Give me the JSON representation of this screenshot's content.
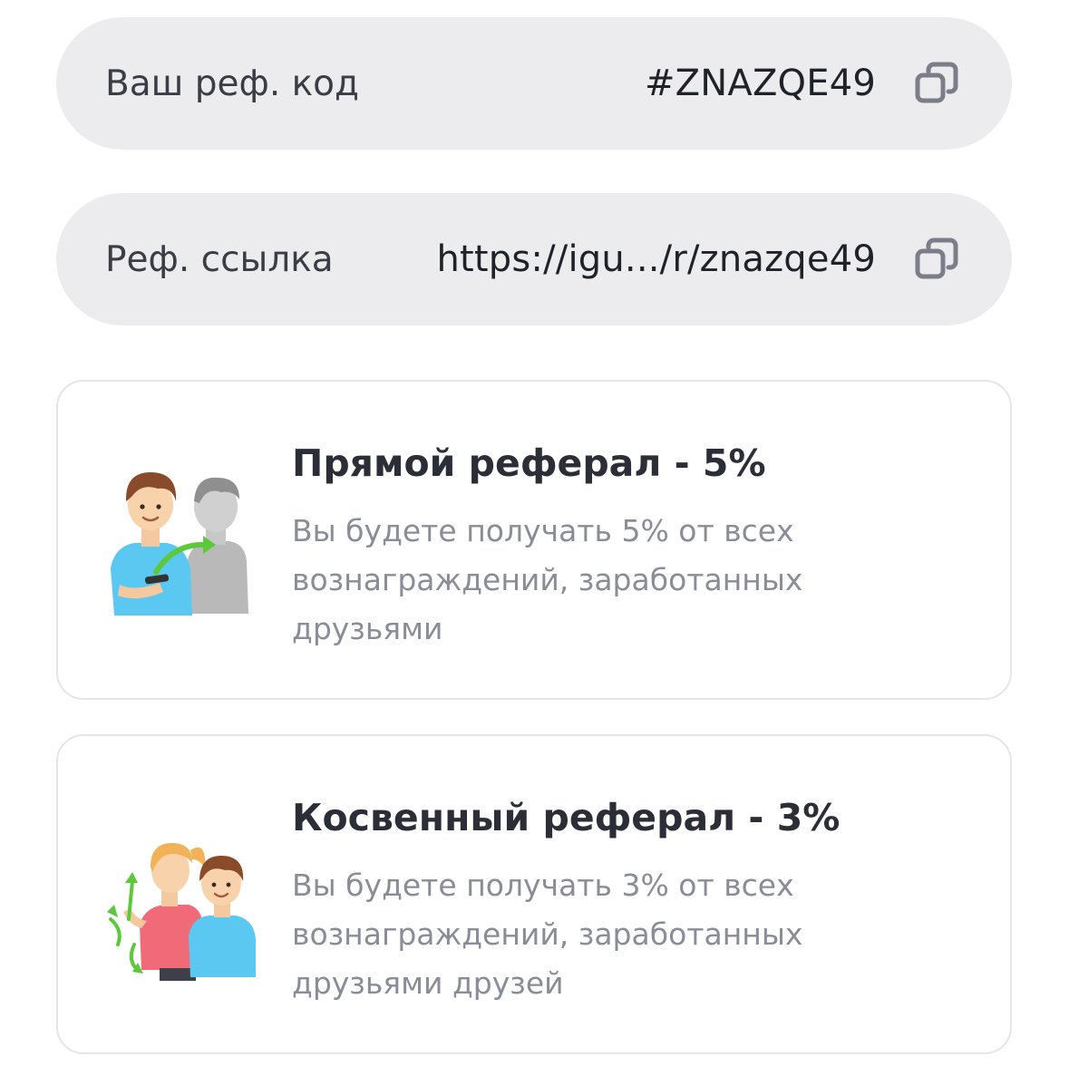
{
  "referral_code": {
    "label": "Ваш реф. код",
    "value": "#ZNAZQE49",
    "copy_icon": "copy-icon"
  },
  "referral_link": {
    "label": "Реф. ссылка",
    "value": "https://igu.../r/znazqe49",
    "copy_icon": "copy-icon"
  },
  "cards": [
    {
      "title": "Прямой реферал - 5%",
      "description": "Вы будете получать 5% от всех вознаграждений, заработанных друзьями",
      "illustration": "direct-referral-illustration"
    },
    {
      "title": "Косвенный реферал - 3%",
      "description": "Вы будете получать 3% от всех вознаграждений, заработанных друзьями друзей",
      "illustration": "indirect-referral-illustration"
    }
  ],
  "colors": {
    "pill_background": "#ececef",
    "card_border": "#e6e6ea",
    "title_text": "#2b2e36",
    "description_text": "#8a8d97",
    "icon_gray": "#7b7e88",
    "accent_green": "#5cc93a",
    "shirt_blue": "#5ac8f0"
  }
}
